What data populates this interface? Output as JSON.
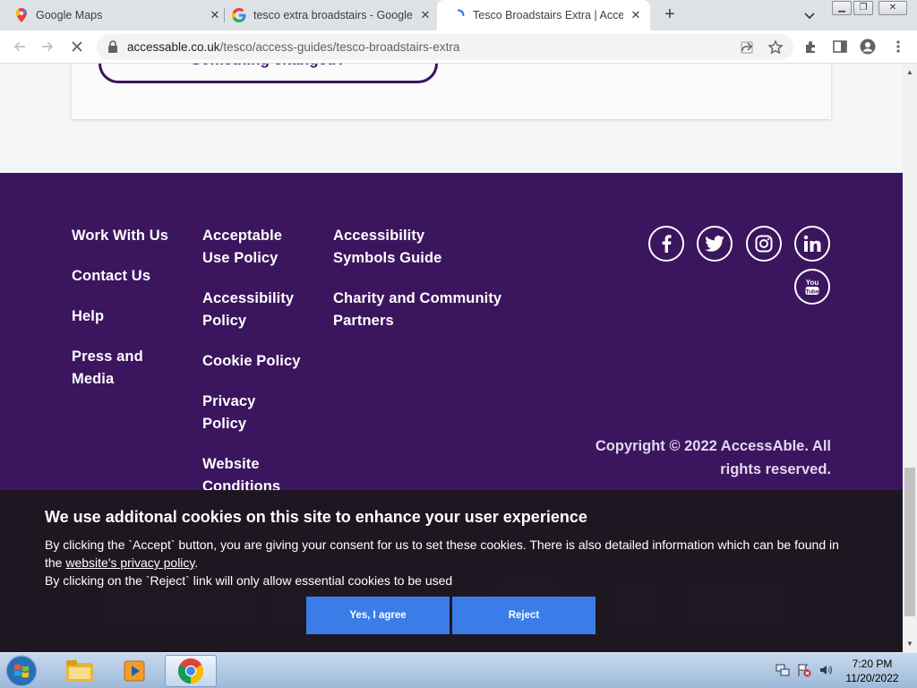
{
  "browser": {
    "tabs": [
      {
        "title": "Google Maps",
        "icon": "google-maps-icon",
        "active": false
      },
      {
        "title": "tesco extra broadstairs - Google",
        "icon": "google-icon",
        "active": false
      },
      {
        "title": "Tesco Broadstairs Extra | AccessA",
        "icon": "loading-spinner-icon",
        "active": true
      }
    ],
    "url_domain": "accessable.co.uk",
    "url_path": "/tesco/access-guides/tesco-broadstairs-extra"
  },
  "page": {
    "changed_button": "Something changed?",
    "footer": {
      "col1": [
        "Work With Us",
        "Contact Us",
        "Help",
        "Press and Media"
      ],
      "col2": [
        "Acceptable Use Policy",
        "Accessibility Policy",
        "Cookie Policy",
        "Privacy Policy",
        "Website Conditions"
      ],
      "col3": [
        "Accessibility Symbols Guide",
        "Charity and Community Partners"
      ],
      "social": [
        "facebook-icon",
        "twitter-icon",
        "instagram-icon",
        "linkedin-icon",
        "youtube-icon"
      ],
      "copyright": "Copyright © 2022 AccessAble. All rights reserved."
    },
    "colors": {
      "footer_bg": "#3b155e",
      "accent": "#3c1361",
      "button_blue": "#3b7de8"
    }
  },
  "cookie_banner": {
    "title": "We use additonal cookies on this site to enhance your user experience",
    "text_before_link": "By clicking the `Accept` button, you are giving your consent for us to set these cookies. There is also detailed information which can be found in the ",
    "link_text": "website's privacy policy",
    "text_after_link": ".",
    "line2": "By clicking on the `Reject` link will only allow essential cookies to be used",
    "accept_label": "Yes, I agree",
    "reject_label": "Reject"
  },
  "taskbar": {
    "time": "7:20 PM",
    "date": "11/20/2022"
  }
}
